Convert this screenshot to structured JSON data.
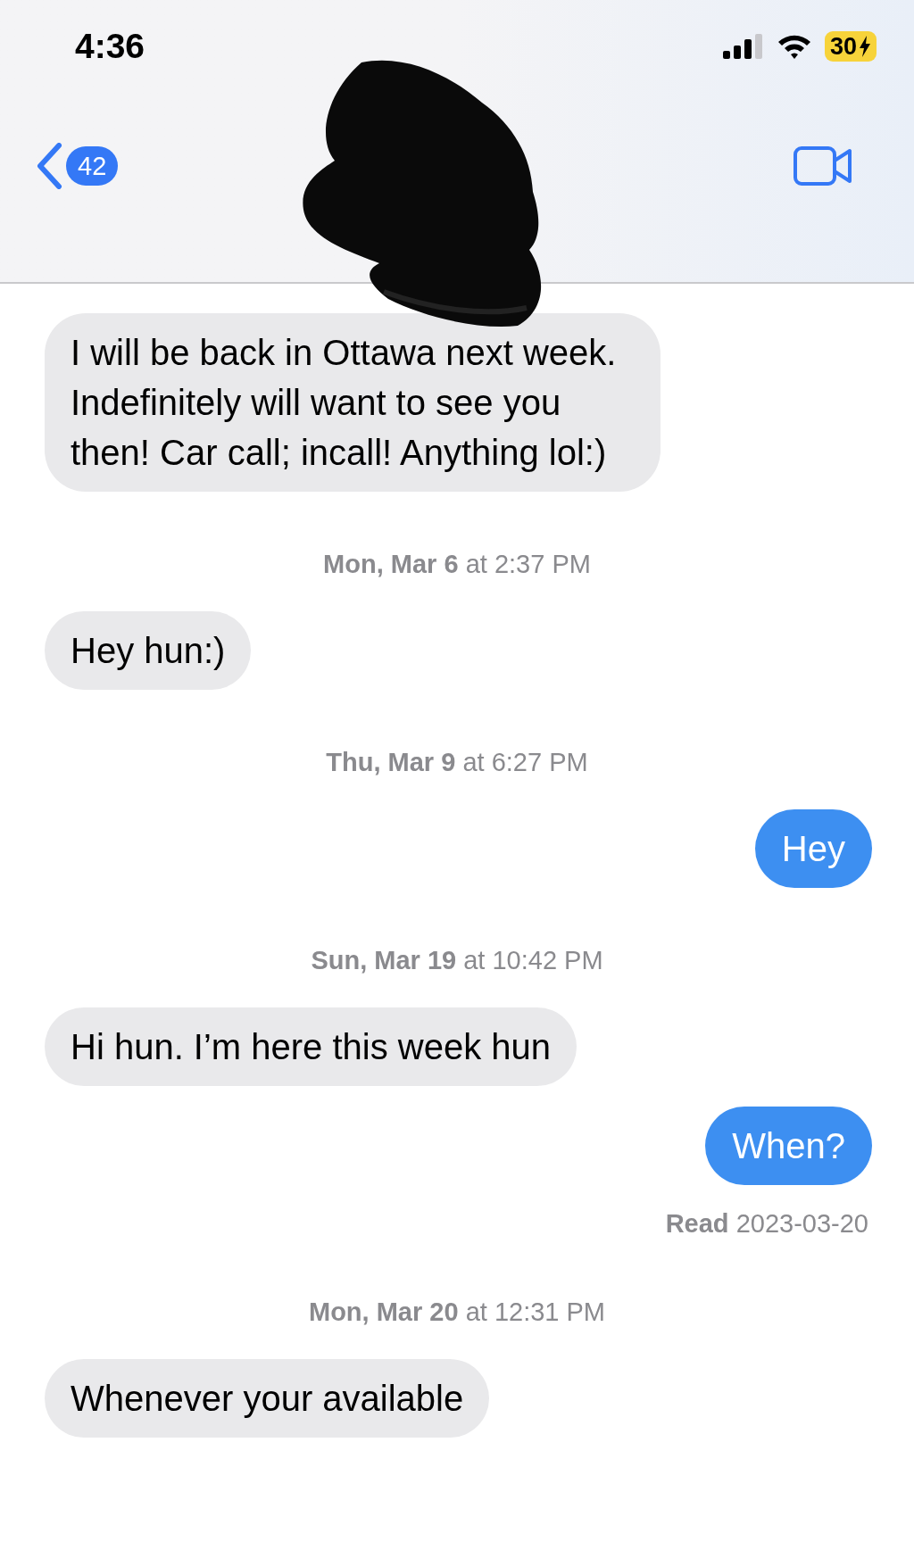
{
  "status_bar": {
    "time": "4:36",
    "battery": "30"
  },
  "header": {
    "back_count": "42"
  },
  "messages": [
    {
      "kind": "received",
      "text": "I will be back in Ottawa next week. Indefinitely will want to see you then! Car call; incall! Anything lol:)"
    },
    {
      "kind": "timestamp",
      "text": "**Mon, Mar 6** at 2:37 PM"
    },
    {
      "kind": "received",
      "text": "Hey hun:)"
    },
    {
      "kind": "timestamp",
      "text": "**Thu, Mar 9** at 6:27 PM"
    },
    {
      "kind": "sent",
      "text": "Hey"
    },
    {
      "kind": "timestamp",
      "text": "**Sun, Mar 19** at 10:42 PM"
    },
    {
      "kind": "received",
      "text": "Hi hun. I’m here this week hun"
    },
    {
      "kind": "sent",
      "text": "When?"
    },
    {
      "kind": "receipt",
      "text": "**Read** 2023-03-20"
    },
    {
      "kind": "timestamp",
      "text": "**Mon, Mar 20** at 12:31 PM"
    },
    {
      "kind": "received",
      "text": "Whenever your available"
    }
  ]
}
